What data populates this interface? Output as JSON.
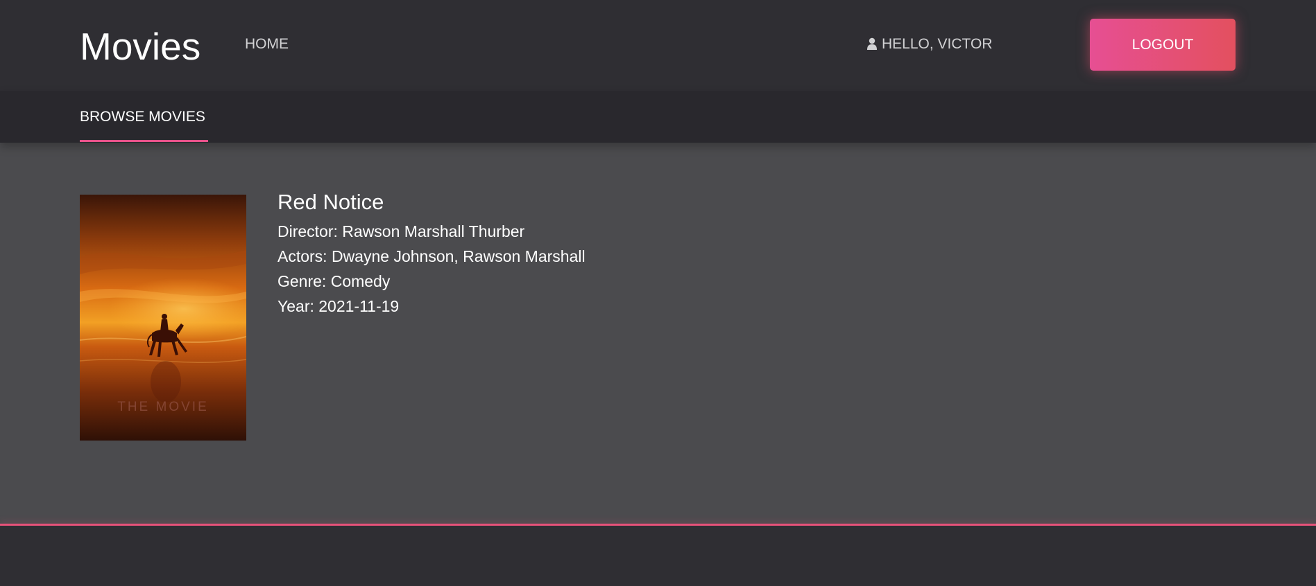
{
  "header": {
    "brand": "Movies",
    "nav_home": "HOME",
    "greeting": "HELLO, VICTOR",
    "logout_label": "LOGOUT",
    "user_icon": "user-icon"
  },
  "subnav": {
    "tab_browse": "BROWSE MOVIES"
  },
  "movie": {
    "title": "Red Notice",
    "director": "Director: Rawson Marshall Thurber",
    "actors": "Actors: Dwayne Johnson, Rawson Marshall",
    "genre": "Genre: Comedy",
    "year": "Year: 2021-11-19",
    "poster_caption": "THE MOVIE"
  },
  "colors": {
    "topbar": "#2f2e33",
    "subnav": "#29282d",
    "content_bg": "#4b4b4e",
    "accent_start": "#e64f93",
    "accent_end": "#e3505f"
  }
}
